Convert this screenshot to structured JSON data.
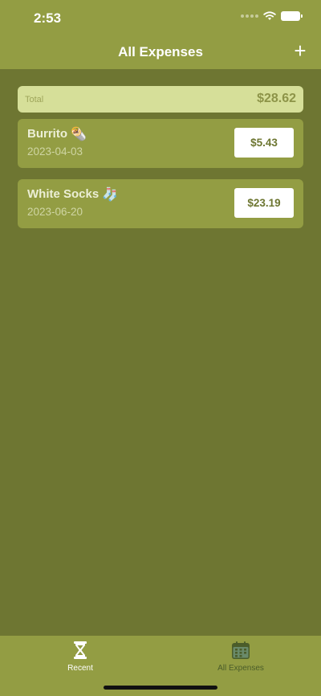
{
  "status_bar": {
    "time": "2:53"
  },
  "nav": {
    "title": "All Expenses",
    "add_label": "+"
  },
  "total": {
    "label": "Total",
    "value": "$28.62"
  },
  "expenses": [
    {
      "name": "Burrito",
      "emoji": "🌯",
      "date": "2023-04-03",
      "amount": "$5.43"
    },
    {
      "name": "White Socks",
      "emoji": "🧦",
      "date": "2023-06-20",
      "amount": "$23.19"
    }
  ],
  "tabs": [
    {
      "label": "Recent",
      "icon": "hourglass-icon",
      "active": false
    },
    {
      "label": "All Expenses",
      "icon": "calendar-icon",
      "active": true
    }
  ],
  "colors": {
    "header": "#939d43",
    "background": "#6e7632",
    "total_card": "#d6df99",
    "active_tab": "#4b5d2a",
    "inactive_tab": "#ffffff"
  }
}
